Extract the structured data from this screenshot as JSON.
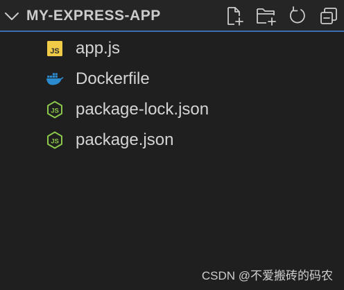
{
  "explorer": {
    "folder_name": "MY-EXPRESS-APP",
    "expanded": true,
    "actions": [
      {
        "name": "new-file",
        "icon": "new-file-icon"
      },
      {
        "name": "new-folder",
        "icon": "new-folder-icon"
      },
      {
        "name": "refresh",
        "icon": "refresh-icon"
      },
      {
        "name": "collapse-all",
        "icon": "collapse-all-icon"
      }
    ],
    "files": [
      {
        "label": "app.js",
        "icon": "javascript-icon"
      },
      {
        "label": "Dockerfile",
        "icon": "docker-icon"
      },
      {
        "label": "package-lock.json",
        "icon": "nodejs-icon"
      },
      {
        "label": "package.json",
        "icon": "nodejs-icon"
      }
    ]
  },
  "colors": {
    "background": "#1f1f1f",
    "header_background": "#252526",
    "focus_border": "#3b6fb6",
    "js_yellow": "#f0cb47",
    "docker_blue": "#2a8ccf",
    "node_green": "#8cc84b"
  },
  "watermark": "CSDN @不爱搬砖的码农"
}
